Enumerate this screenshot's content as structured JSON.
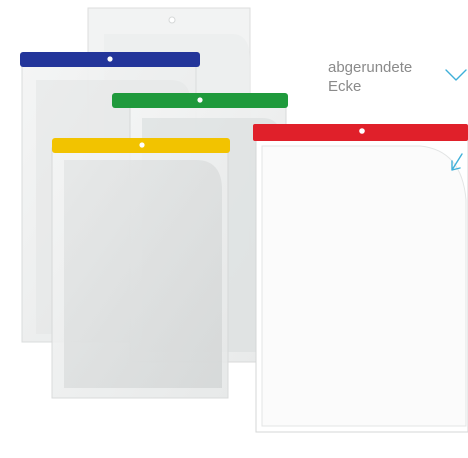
{
  "annotation": {
    "line1": "abgerundete",
    "line2": "Ecke",
    "arrow_color": "#3fb0d9"
  },
  "pockets": [
    {
      "name": "plain-pocket",
      "strip_color": "none"
    },
    {
      "name": "blue-pocket",
      "strip_color": "#23359a"
    },
    {
      "name": "green-pocket",
      "strip_color": "#1f9a3c"
    },
    {
      "name": "yellow-pocket",
      "strip_color": "#f2c300"
    },
    {
      "name": "red-pocket",
      "strip_color": "#e0202a"
    }
  ]
}
